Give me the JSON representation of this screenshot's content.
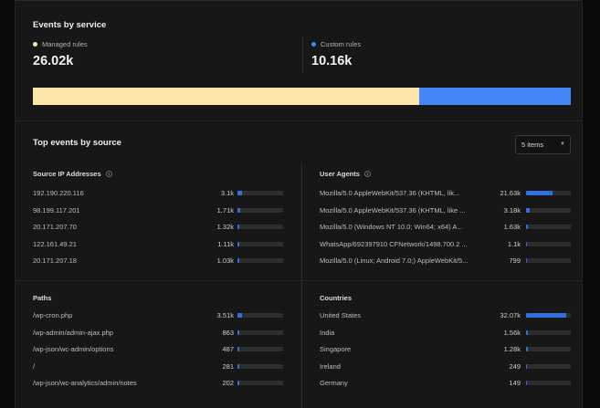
{
  "events_by_service": {
    "title": "Events by service",
    "managed": {
      "label": "Managed rules",
      "value": "26.02k",
      "color": "#fde6a7",
      "share": 0.719
    },
    "custom": {
      "label": "Custom rules",
      "value": "10.16k",
      "color": "#4287f5",
      "share": 0.281
    }
  },
  "top_events": {
    "title": "Top events by source",
    "items_select": "5 items",
    "source_ip": {
      "header": "Source IP Addresses",
      "rows": [
        {
          "label": "192.190.220.116",
          "value": "3.1k",
          "fraction": 0.09
        },
        {
          "label": "98.199.117.201",
          "value": "1.71k",
          "fraction": 0.05
        },
        {
          "label": "20.171.207.70",
          "value": "1.32k",
          "fraction": 0.04
        },
        {
          "label": "122.161.49.21",
          "value": "1.11k",
          "fraction": 0.035
        },
        {
          "label": "20.171.207.18",
          "value": "1.03k",
          "fraction": 0.03
        }
      ]
    },
    "user_agents": {
      "header": "User Agents",
      "rows": [
        {
          "label": "Mozilla/5.0 AppleWebKit/537.36 (KHTML, lik...",
          "value": "21.63k",
          "fraction": 0.6
        },
        {
          "label": "Mozilla/5.0 AppleWebKit/537.36 (KHTML, like ...",
          "value": "3.18k",
          "fraction": 0.09
        },
        {
          "label": "Mozilla/5.0 (Windows NT 10.0; Win64; x64) A...",
          "value": "1.63k",
          "fraction": 0.045
        },
        {
          "label": "WhatsApp/692397910 CFNetwork/1498.700.2 ...",
          "value": "1.1k",
          "fraction": 0.03
        },
        {
          "label": "Mozilla/5.0 (Linux; Android 7.0;) AppleWebKit/5...",
          "value": "799",
          "fraction": 0.022
        }
      ]
    },
    "paths": {
      "header": "Paths",
      "rows": [
        {
          "label": "/wp-cron.php",
          "value": "3.51k",
          "fraction": 0.1
        },
        {
          "label": "/wp-admin/admin-ajax.php",
          "value": "863",
          "fraction": 0.025
        },
        {
          "label": "/wp-json/wc-admin/options",
          "value": "487",
          "fraction": 0.014
        },
        {
          "label": "/",
          "value": "281",
          "fraction": 0.008
        },
        {
          "label": "/wp-json/wc-analytics/admin/notes",
          "value": "202",
          "fraction": 0.006
        }
      ]
    },
    "countries": {
      "header": "Countries",
      "rows": [
        {
          "label": "United States",
          "value": "32.07k",
          "fraction": 0.89
        },
        {
          "label": "India",
          "value": "1.56k",
          "fraction": 0.043
        },
        {
          "label": "Singapore",
          "value": "1.28k",
          "fraction": 0.036
        },
        {
          "label": "Ireland",
          "value": "249",
          "fraction": 0.007
        },
        {
          "label": "Germany",
          "value": "149",
          "fraction": 0.004
        }
      ]
    }
  }
}
